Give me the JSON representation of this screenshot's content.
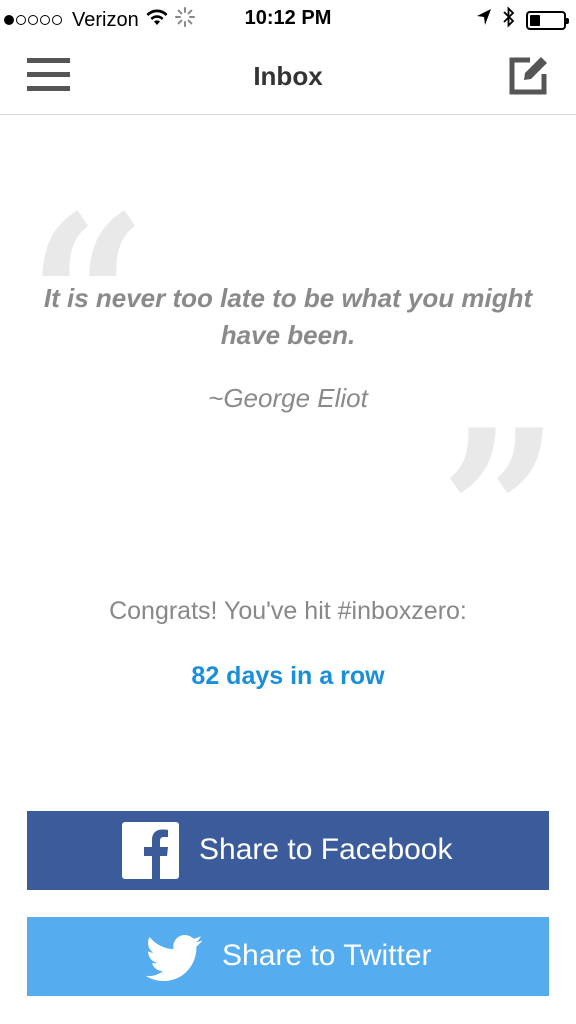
{
  "status_bar": {
    "carrier": "Verizon",
    "time": "10:12 PM",
    "signal_bars_filled": 1,
    "signal_bars_total": 5,
    "battery_level": 0.25
  },
  "nav": {
    "title": "Inbox",
    "menu_icon": "hamburger-menu-icon",
    "compose_icon": "compose-icon"
  },
  "quote": {
    "open_mark": "“",
    "close_mark": "”",
    "text": "It is never too late to be what you might have been.",
    "author": "~George Eliot"
  },
  "congrats": {
    "message": "Congrats! You've hit #inboxzero:",
    "streak": "82 days in a row"
  },
  "share": {
    "facebook_label": "Share to Facebook",
    "twitter_label": "Share to Twitter"
  },
  "colors": {
    "facebook": "#3b5b9a",
    "twitter": "#55acee",
    "streak_accent": "#1a8fd9"
  }
}
